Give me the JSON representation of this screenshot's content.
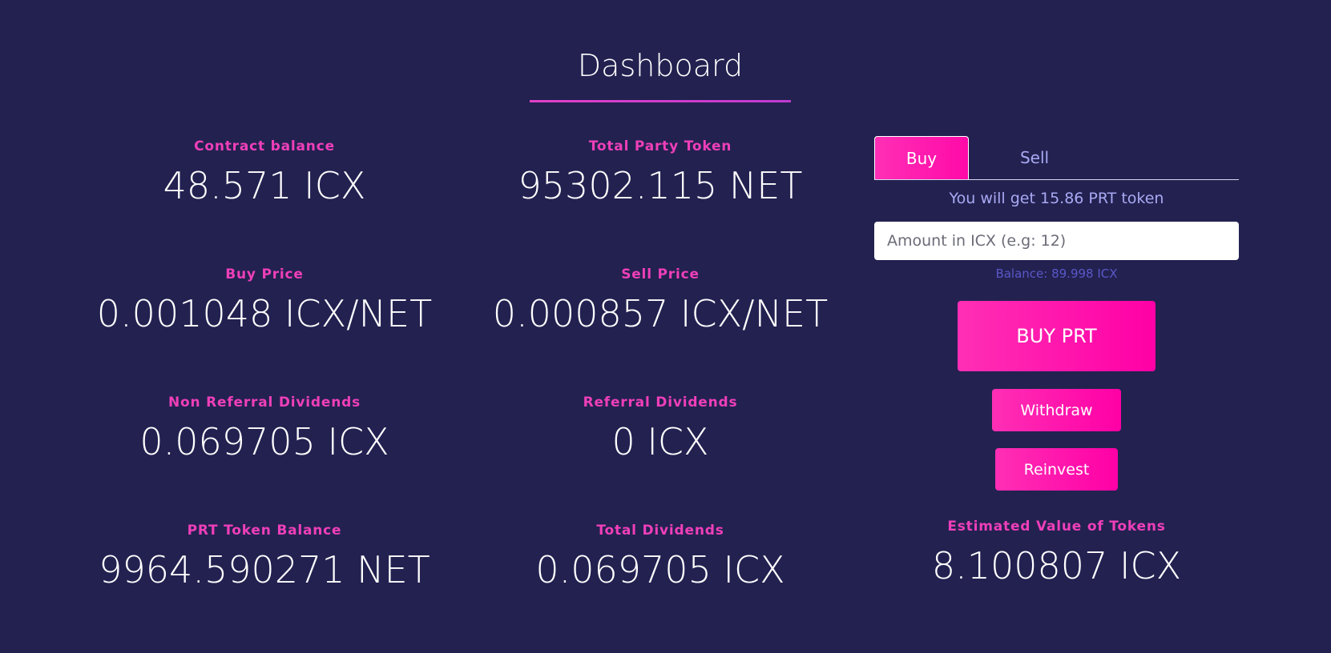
{
  "header": {
    "title": "Dashboard"
  },
  "stats": {
    "contract_balance": {
      "label": "Contract balance",
      "value": "48.571 ICX"
    },
    "total_party_token": {
      "label": "Total Party Token",
      "value": "95302.115 NET"
    },
    "buy_price": {
      "label": "Buy Price",
      "value": "0.001048 ICX/NET"
    },
    "sell_price": {
      "label": "Sell Price",
      "value": "0.000857 ICX/NET"
    },
    "non_referral_dividends": {
      "label": "Non Referral Dividends",
      "value": "0.069705 ICX"
    },
    "referral_dividends": {
      "label": "Referral Dividends",
      "value": "0 ICX"
    },
    "prt_token_balance": {
      "label": "PRT Token Balance",
      "value": "9964.590271 NET"
    },
    "total_dividends": {
      "label": "Total Dividends",
      "value": "0.069705 ICX"
    }
  },
  "trade": {
    "tabs": {
      "buy": "Buy",
      "sell": "Sell",
      "active": "buy"
    },
    "get_text": "You will get 15.86 PRT token",
    "amount_input": {
      "value": "",
      "placeholder": "Amount in ICX (e.g: 12)"
    },
    "balance_text": "Balance: 89.998 ICX",
    "buy_button": "BUY PRT",
    "withdraw_button": "Withdraw",
    "reinvest_button": "Reinvest",
    "estimated": {
      "label": "Estimated Value of Tokens",
      "value": "8.100807 ICX"
    }
  },
  "colors": {
    "background": "#232150",
    "accent": "#ff0aa8",
    "label": "#ef3fb9",
    "muted": "#a9a9f3",
    "balance": "#5a58c8"
  }
}
